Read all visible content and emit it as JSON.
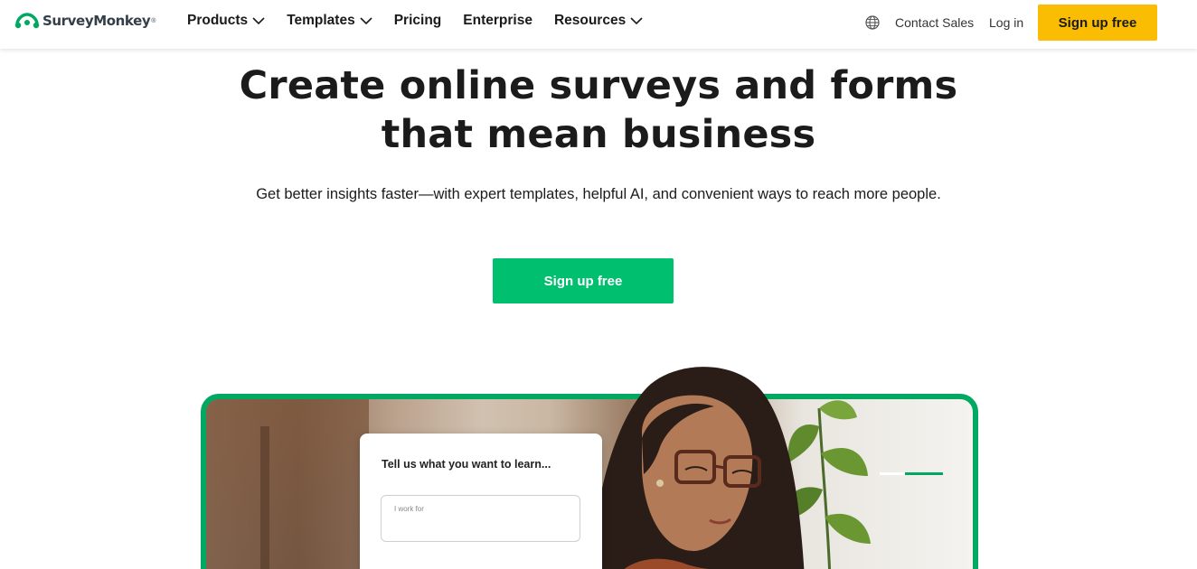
{
  "brand": {
    "name": "SurveyMonkey",
    "trademark": "®",
    "color": "#00bf6f"
  },
  "nav": {
    "items": [
      {
        "label": "Products",
        "has_dropdown": true
      },
      {
        "label": "Templates",
        "has_dropdown": true
      },
      {
        "label": "Pricing",
        "has_dropdown": false
      },
      {
        "label": "Enterprise",
        "has_dropdown": false
      },
      {
        "label": "Resources",
        "has_dropdown": true
      }
    ]
  },
  "header": {
    "globe_icon": "globe-icon",
    "contact_sales": "Contact Sales",
    "login": "Log in",
    "signup": "Sign up free",
    "signup_color": "#fbbc04"
  },
  "hero": {
    "title_line1": "Create online surveys and forms",
    "title_line2": "that mean business",
    "subtitle": "Get better insights faster—with expert templates, helpful AI, and convenient ways to reach more people.",
    "cta": "Sign up free",
    "cta_color": "#00bf6f"
  },
  "media": {
    "frame_color": "#00a862",
    "card_question": "Tell us what you want to learn...",
    "card_input_placeholder": "I work for",
    "carousel_progress": 0.6
  }
}
